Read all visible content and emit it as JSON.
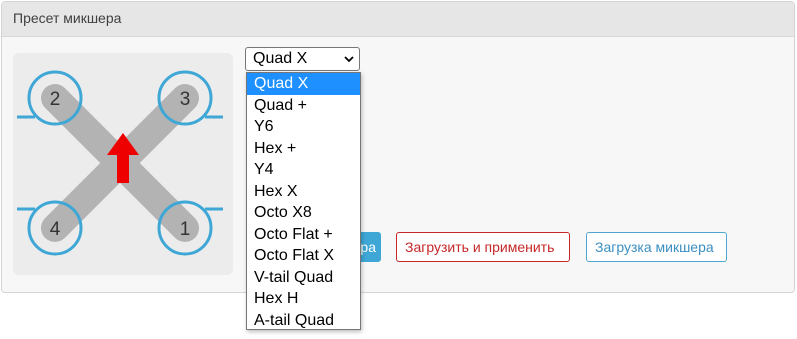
{
  "panel": {
    "title": "Пресет микшера"
  },
  "mixer_select": {
    "value": "Quad X",
    "options": [
      "Quad X",
      "Quad +",
      "Y6",
      "Hex +",
      "Y4",
      "Hex X",
      "Octo X8",
      "Octo Flat +",
      "Octo Flat X",
      "V-tail Quad",
      "Hex H",
      "A-tail Quad"
    ]
  },
  "diagram": {
    "motors": [
      {
        "label": "1",
        "position": "bottom-right"
      },
      {
        "label": "2",
        "position": "top-left"
      },
      {
        "label": "3",
        "position": "top-right"
      },
      {
        "label": "4",
        "position": "bottom-left"
      }
    ],
    "arm_color": "#b3b3b3",
    "rotation_color": "#3fa7d6",
    "arrow_color": "#ee0000"
  },
  "buttons": {
    "partial_label": "ра",
    "load_apply": "Загрузить и применить",
    "load_mixer": "Загрузка микшера"
  }
}
